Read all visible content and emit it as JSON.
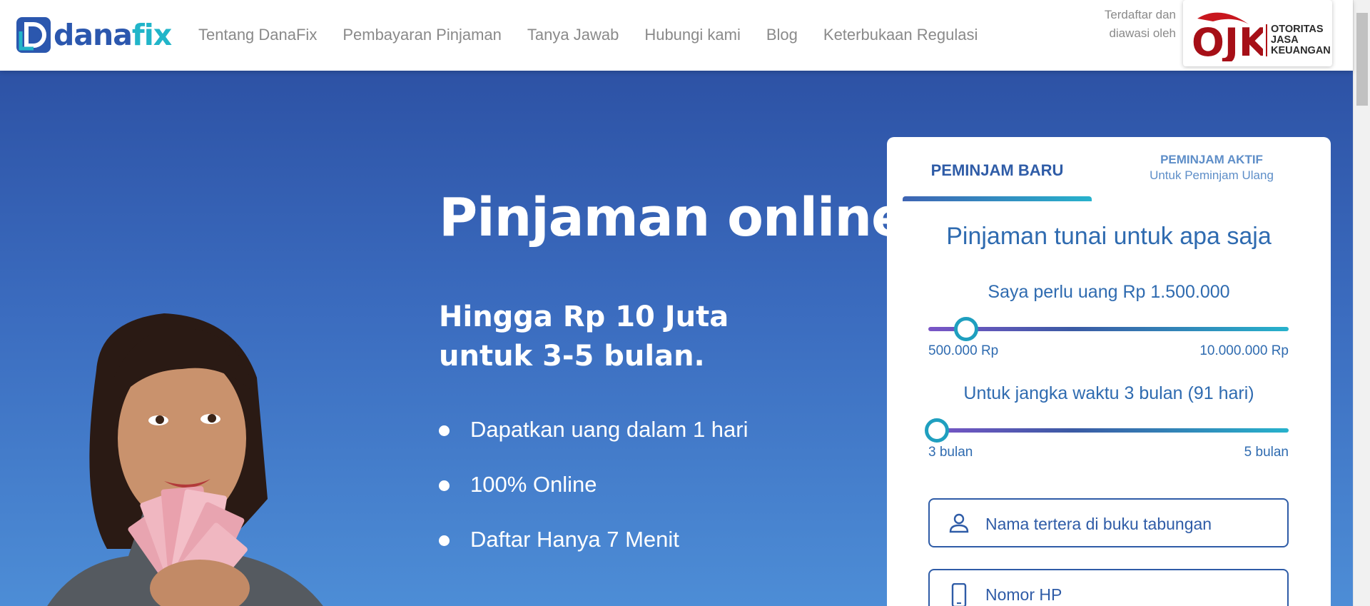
{
  "brand": {
    "name_part1": "dana",
    "name_part2": "fix",
    "color_primary": "#2b57ae",
    "color_accent": "#21b5c9"
  },
  "nav": {
    "items": [
      "Tentang DanaFix",
      "Pembayaran Pinjaman",
      "Tanya Jawab",
      "Hubungi kami",
      "Blog",
      "Keterbukaan Regulasi"
    ]
  },
  "ojk": {
    "note_line1": "Terdaftar dan",
    "note_line2": "diawasi oleh",
    "logo_text": "OJK",
    "org_line1": "OTORITAS",
    "org_line2": "JASA",
    "org_line3": "KEUANGAN"
  },
  "hero": {
    "title": "Pinjaman online",
    "subtitle_line1": "Hingga Rp 10 Juta",
    "subtitle_line2": "untuk 3-5 bulan.",
    "bullets": [
      "Dapatkan uang dalam 1 hari",
      "100% Online",
      "Daftar Hanya 7 Menit"
    ]
  },
  "form": {
    "tabs": [
      {
        "label": "PEMINJAM BARU",
        "active": true
      },
      {
        "label": "PEMINJAM AKTIF",
        "sublabel": "Untuk Peminjam Ulang",
        "active": false
      }
    ],
    "heading": "Pinjaman tunai untuk apa saja",
    "amount": {
      "label": "Saya perlu uang Rp 1.500.000",
      "min_label": "500.000 Rp",
      "max_label": "10.000.000 Rp",
      "min": 500000,
      "max": 10000000,
      "value": 1500000
    },
    "term": {
      "label": "Untuk jangka waktu 3 bulan (91 hari)",
      "min_label": "3 bulan",
      "max_label": "5 bulan",
      "min": 3,
      "max": 5,
      "value": 3
    },
    "fields": [
      {
        "label": "Nama tertera di buku tabungan",
        "icon": "person-icon"
      },
      {
        "label": "Nomor HP",
        "icon": "phone-icon"
      }
    ]
  }
}
